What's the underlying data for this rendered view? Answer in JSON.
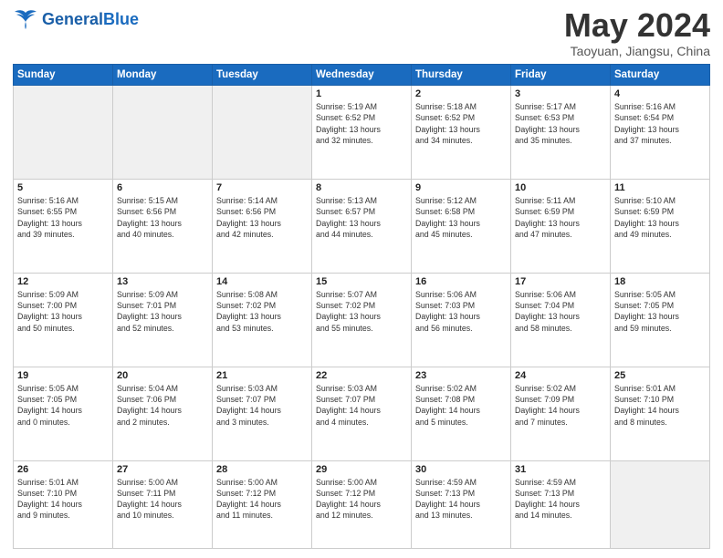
{
  "header": {
    "logo_general": "General",
    "logo_blue": "Blue",
    "month_title": "May 2024",
    "location": "Taoyuan, Jiangsu, China"
  },
  "days_of_week": [
    "Sunday",
    "Monday",
    "Tuesday",
    "Wednesday",
    "Thursday",
    "Friday",
    "Saturday"
  ],
  "weeks": [
    [
      {
        "num": "",
        "info": ""
      },
      {
        "num": "",
        "info": ""
      },
      {
        "num": "",
        "info": ""
      },
      {
        "num": "1",
        "info": "Sunrise: 5:19 AM\nSunset: 6:52 PM\nDaylight: 13 hours\nand 32 minutes."
      },
      {
        "num": "2",
        "info": "Sunrise: 5:18 AM\nSunset: 6:52 PM\nDaylight: 13 hours\nand 34 minutes."
      },
      {
        "num": "3",
        "info": "Sunrise: 5:17 AM\nSunset: 6:53 PM\nDaylight: 13 hours\nand 35 minutes."
      },
      {
        "num": "4",
        "info": "Sunrise: 5:16 AM\nSunset: 6:54 PM\nDaylight: 13 hours\nand 37 minutes."
      }
    ],
    [
      {
        "num": "5",
        "info": "Sunrise: 5:16 AM\nSunset: 6:55 PM\nDaylight: 13 hours\nand 39 minutes."
      },
      {
        "num": "6",
        "info": "Sunrise: 5:15 AM\nSunset: 6:56 PM\nDaylight: 13 hours\nand 40 minutes."
      },
      {
        "num": "7",
        "info": "Sunrise: 5:14 AM\nSunset: 6:56 PM\nDaylight: 13 hours\nand 42 minutes."
      },
      {
        "num": "8",
        "info": "Sunrise: 5:13 AM\nSunset: 6:57 PM\nDaylight: 13 hours\nand 44 minutes."
      },
      {
        "num": "9",
        "info": "Sunrise: 5:12 AM\nSunset: 6:58 PM\nDaylight: 13 hours\nand 45 minutes."
      },
      {
        "num": "10",
        "info": "Sunrise: 5:11 AM\nSunset: 6:59 PM\nDaylight: 13 hours\nand 47 minutes."
      },
      {
        "num": "11",
        "info": "Sunrise: 5:10 AM\nSunset: 6:59 PM\nDaylight: 13 hours\nand 49 minutes."
      }
    ],
    [
      {
        "num": "12",
        "info": "Sunrise: 5:09 AM\nSunset: 7:00 PM\nDaylight: 13 hours\nand 50 minutes."
      },
      {
        "num": "13",
        "info": "Sunrise: 5:09 AM\nSunset: 7:01 PM\nDaylight: 13 hours\nand 52 minutes."
      },
      {
        "num": "14",
        "info": "Sunrise: 5:08 AM\nSunset: 7:02 PM\nDaylight: 13 hours\nand 53 minutes."
      },
      {
        "num": "15",
        "info": "Sunrise: 5:07 AM\nSunset: 7:02 PM\nDaylight: 13 hours\nand 55 minutes."
      },
      {
        "num": "16",
        "info": "Sunrise: 5:06 AM\nSunset: 7:03 PM\nDaylight: 13 hours\nand 56 minutes."
      },
      {
        "num": "17",
        "info": "Sunrise: 5:06 AM\nSunset: 7:04 PM\nDaylight: 13 hours\nand 58 minutes."
      },
      {
        "num": "18",
        "info": "Sunrise: 5:05 AM\nSunset: 7:05 PM\nDaylight: 13 hours\nand 59 minutes."
      }
    ],
    [
      {
        "num": "19",
        "info": "Sunrise: 5:05 AM\nSunset: 7:05 PM\nDaylight: 14 hours\nand 0 minutes."
      },
      {
        "num": "20",
        "info": "Sunrise: 5:04 AM\nSunset: 7:06 PM\nDaylight: 14 hours\nand 2 minutes."
      },
      {
        "num": "21",
        "info": "Sunrise: 5:03 AM\nSunset: 7:07 PM\nDaylight: 14 hours\nand 3 minutes."
      },
      {
        "num": "22",
        "info": "Sunrise: 5:03 AM\nSunset: 7:07 PM\nDaylight: 14 hours\nand 4 minutes."
      },
      {
        "num": "23",
        "info": "Sunrise: 5:02 AM\nSunset: 7:08 PM\nDaylight: 14 hours\nand 5 minutes."
      },
      {
        "num": "24",
        "info": "Sunrise: 5:02 AM\nSunset: 7:09 PM\nDaylight: 14 hours\nand 7 minutes."
      },
      {
        "num": "25",
        "info": "Sunrise: 5:01 AM\nSunset: 7:10 PM\nDaylight: 14 hours\nand 8 minutes."
      }
    ],
    [
      {
        "num": "26",
        "info": "Sunrise: 5:01 AM\nSunset: 7:10 PM\nDaylight: 14 hours\nand 9 minutes."
      },
      {
        "num": "27",
        "info": "Sunrise: 5:00 AM\nSunset: 7:11 PM\nDaylight: 14 hours\nand 10 minutes."
      },
      {
        "num": "28",
        "info": "Sunrise: 5:00 AM\nSunset: 7:12 PM\nDaylight: 14 hours\nand 11 minutes."
      },
      {
        "num": "29",
        "info": "Sunrise: 5:00 AM\nSunset: 7:12 PM\nDaylight: 14 hours\nand 12 minutes."
      },
      {
        "num": "30",
        "info": "Sunrise: 4:59 AM\nSunset: 7:13 PM\nDaylight: 14 hours\nand 13 minutes."
      },
      {
        "num": "31",
        "info": "Sunrise: 4:59 AM\nSunset: 7:13 PM\nDaylight: 14 hours\nand 14 minutes."
      },
      {
        "num": "",
        "info": ""
      }
    ]
  ]
}
